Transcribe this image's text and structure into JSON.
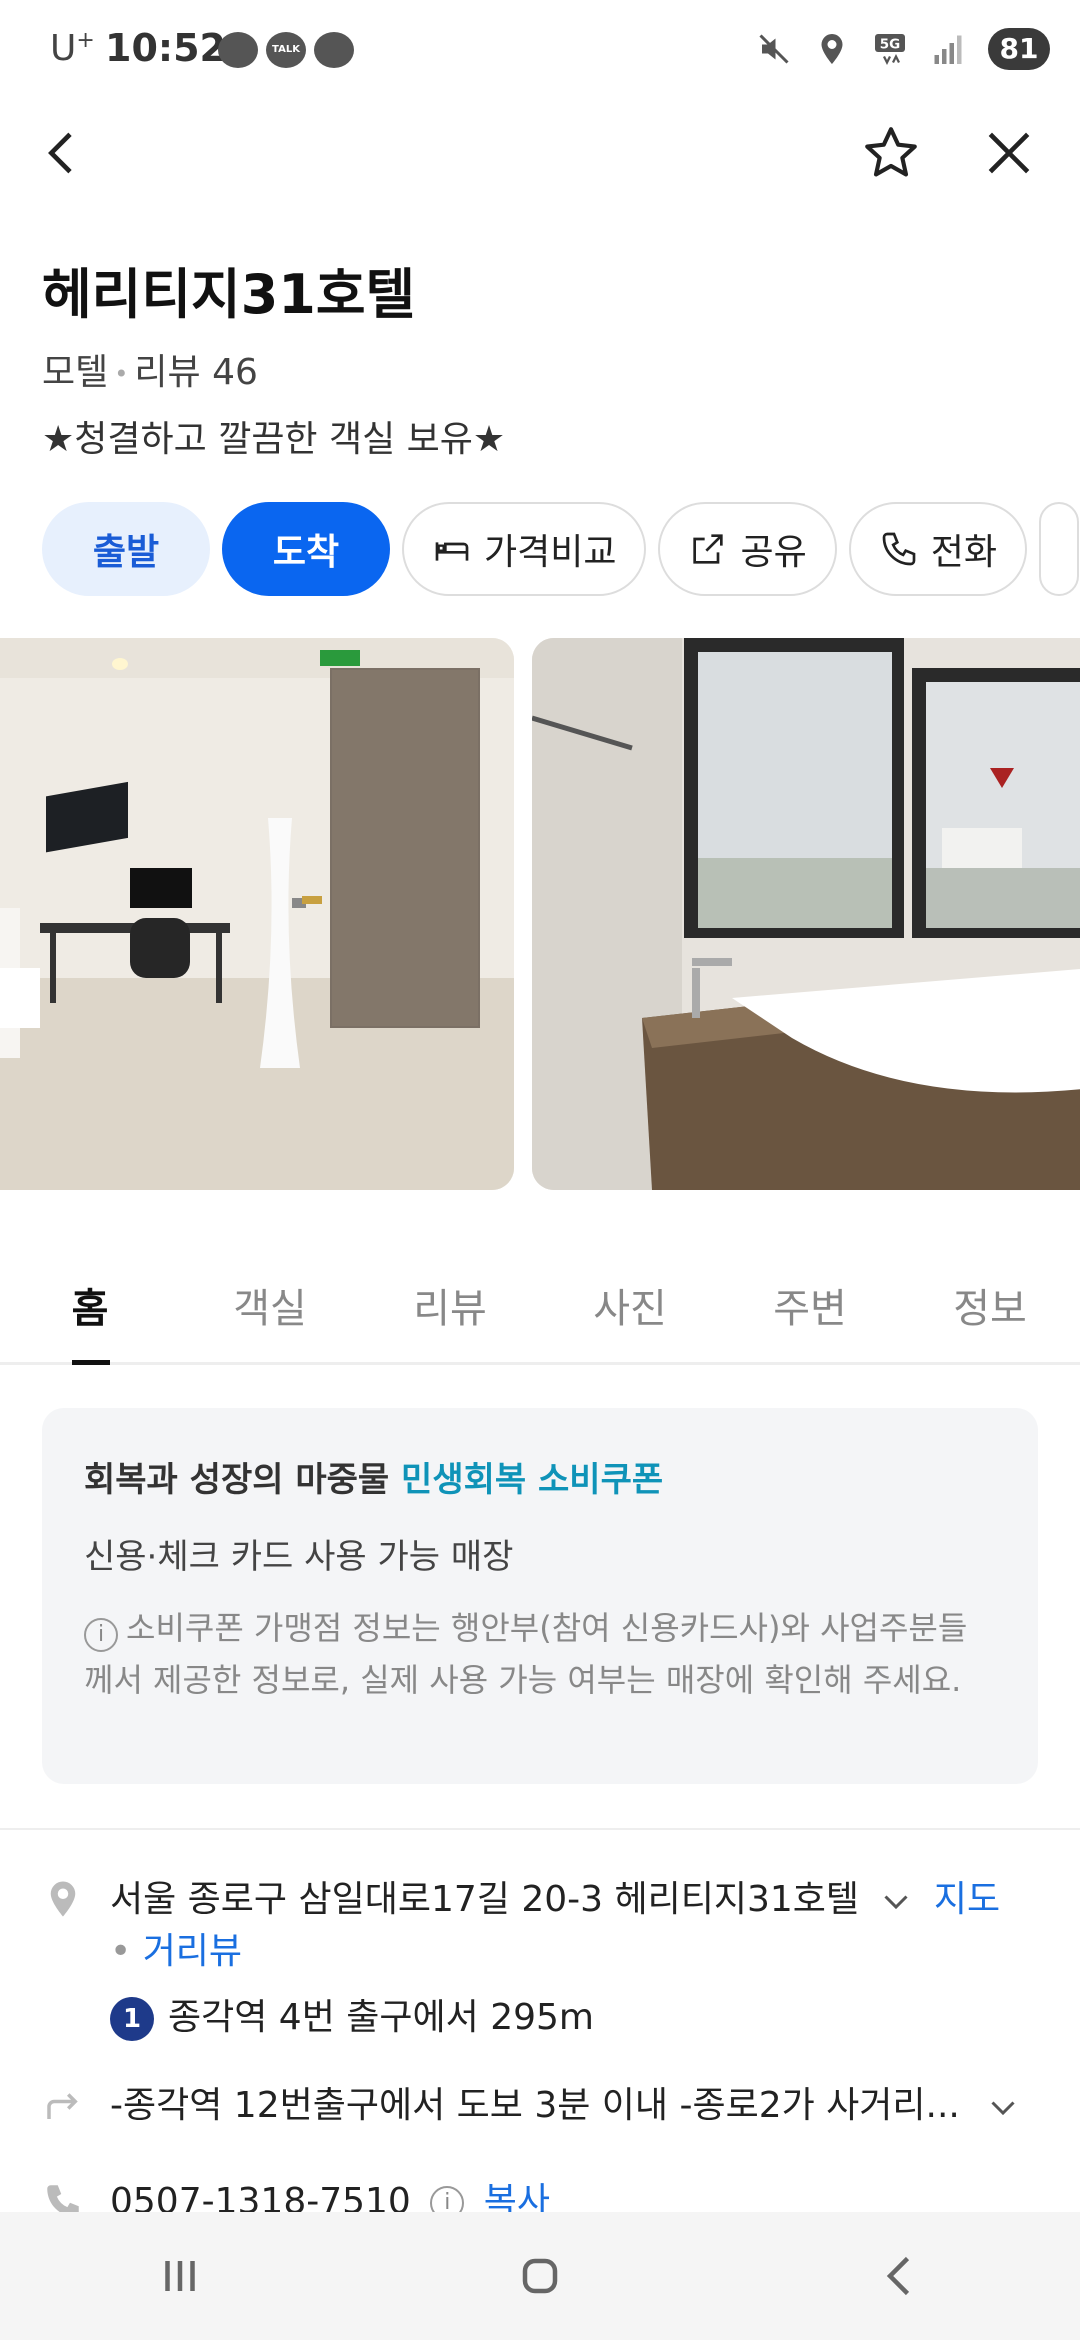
{
  "status_bar": {
    "carrier": "U",
    "carrier_plus": "+",
    "time": "10:52",
    "notifications": [
      "TALK"
    ],
    "network": "5G",
    "battery": "81"
  },
  "place": {
    "name": "헤리티지31호텔",
    "category": "모텔",
    "review_label": "리뷰 46",
    "description": "★청결하고 깔끔한 객실 보유★"
  },
  "actions": {
    "depart": "출발",
    "arrive": "도착",
    "compare": "가격비교",
    "share": "공유",
    "call": "전화"
  },
  "tabs": [
    "홈",
    "객실",
    "리뷰",
    "사진",
    "주변",
    "정보"
  ],
  "active_tab": "홈",
  "coupon": {
    "headline_prefix": "회복과 성장의 마중물",
    "headline_highlight": "민생회복 소비쿠폰",
    "subtitle": "신용·체크 카드 사용 가능 매장",
    "note": "소비쿠폰 가맹점 정보는 행안부(참여 신용카드사)와 사업주분들께서 제공한 정보로, 실제 사용 가능 여부는 매장에 확인해 주세요."
  },
  "info": {
    "address": "서울 종로구 삼일대로17길 20-3 헤리티지31호텔",
    "map_link": "지도",
    "street_view": "거리뷰",
    "station_line": "1",
    "station_text": "종각역 4번 출구에서 295m",
    "directions": "-종각역 12번출구에서 도보 3분 이내 -종로2가 사거리...",
    "phone": "0507-1318-7510",
    "copy": "복사"
  },
  "colors": {
    "accent": "#0a66f0",
    "accent_light": "#e7f0fd",
    "highlight": "#0f93b8",
    "link": "#1a6fe0"
  }
}
